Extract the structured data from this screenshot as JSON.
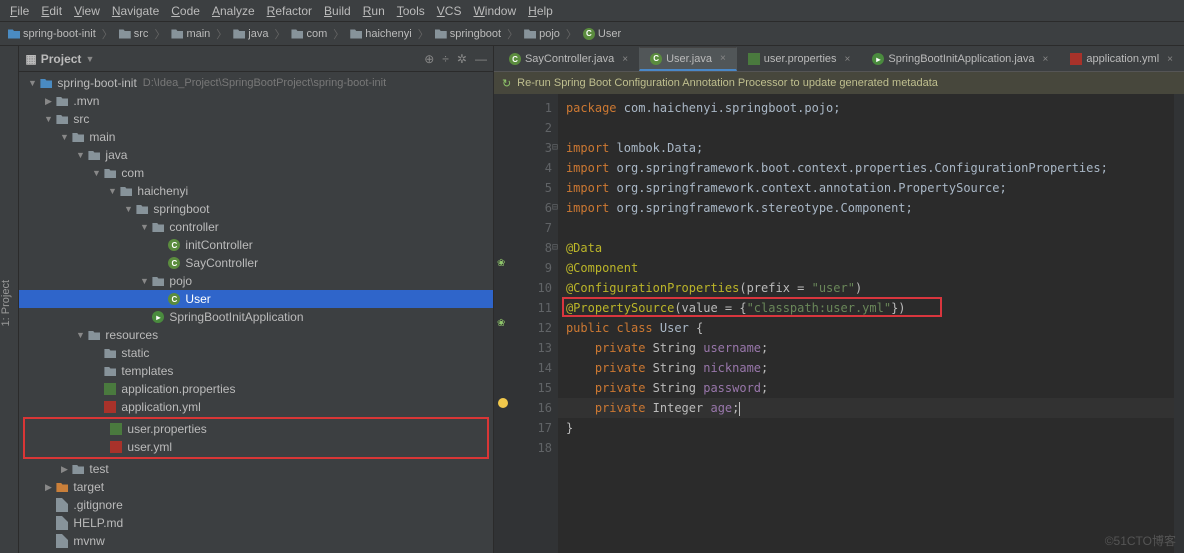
{
  "menu": [
    "File",
    "Edit",
    "View",
    "Navigate",
    "Code",
    "Analyze",
    "Refactor",
    "Build",
    "Run",
    "Tools",
    "VCS",
    "Window",
    "Help"
  ],
  "breadcrumbs": [
    {
      "icon": "folder-blue",
      "label": "spring-boot-init"
    },
    {
      "icon": "folder",
      "label": "src"
    },
    {
      "icon": "folder",
      "label": "main"
    },
    {
      "icon": "folder",
      "label": "java"
    },
    {
      "icon": "folder",
      "label": "com"
    },
    {
      "icon": "folder",
      "label": "haichenyi"
    },
    {
      "icon": "folder",
      "label": "springboot"
    },
    {
      "icon": "folder",
      "label": "pojo"
    },
    {
      "icon": "class",
      "label": "User"
    }
  ],
  "sidebar": {
    "title": "Project",
    "vertical_tab": "1: Project",
    "tree": [
      {
        "d": 0,
        "c": "▼",
        "i": "folder-blue",
        "l": "spring-boot-init",
        "h": "D:\\Idea_Project\\SpringBootProject\\spring-boot-init"
      },
      {
        "d": 1,
        "c": "▶",
        "i": "folder",
        "l": ".mvn"
      },
      {
        "d": 1,
        "c": "▼",
        "i": "folder",
        "l": "src"
      },
      {
        "d": 2,
        "c": "▼",
        "i": "folder",
        "l": "main"
      },
      {
        "d": 3,
        "c": "▼",
        "i": "folder",
        "l": "java"
      },
      {
        "d": 4,
        "c": "▼",
        "i": "folder",
        "l": "com"
      },
      {
        "d": 5,
        "c": "▼",
        "i": "folder",
        "l": "haichenyi"
      },
      {
        "d": 6,
        "c": "▼",
        "i": "folder",
        "l": "springboot"
      },
      {
        "d": 7,
        "c": "▼",
        "i": "folder",
        "l": "controller"
      },
      {
        "d": 8,
        "c": "",
        "i": "class",
        "l": "initController"
      },
      {
        "d": 8,
        "c": "",
        "i": "class",
        "l": "SayController"
      },
      {
        "d": 7,
        "c": "▼",
        "i": "folder",
        "l": "pojo"
      },
      {
        "d": 8,
        "c": "",
        "i": "class",
        "l": "User",
        "sel": true
      },
      {
        "d": 7,
        "c": "",
        "i": "class-run",
        "l": "SpringBootInitApplication"
      },
      {
        "d": 3,
        "c": "▼",
        "i": "folder",
        "l": "resources"
      },
      {
        "d": 4,
        "c": "",
        "i": "folder",
        "l": "static"
      },
      {
        "d": 4,
        "c": "",
        "i": "folder",
        "l": "templates"
      },
      {
        "d": 4,
        "c": "",
        "i": "prop",
        "l": "application.properties"
      },
      {
        "d": 4,
        "c": "",
        "i": "yml",
        "l": "application.yml"
      }
    ],
    "tree_boxed": [
      {
        "d": 4,
        "c": "",
        "i": "prop",
        "l": "user.properties"
      },
      {
        "d": 4,
        "c": "",
        "i": "yml",
        "l": "user.yml"
      }
    ],
    "tree_after": [
      {
        "d": 2,
        "c": "▶",
        "i": "folder",
        "l": "test"
      },
      {
        "d": 1,
        "c": "▶",
        "i": "folder-orange",
        "l": "target"
      },
      {
        "d": 1,
        "c": "",
        "i": "file",
        "l": ".gitignore"
      },
      {
        "d": 1,
        "c": "",
        "i": "file",
        "l": "HELP.md"
      },
      {
        "d": 1,
        "c": "",
        "i": "file",
        "l": "mvnw"
      }
    ]
  },
  "editor": {
    "tabs": [
      {
        "label": "SayController.java",
        "icon": "class"
      },
      {
        "label": "User.java",
        "icon": "class",
        "active": true
      },
      {
        "label": "user.properties",
        "icon": "prop"
      },
      {
        "label": "SpringBootInitApplication.java",
        "icon": "class-run"
      },
      {
        "label": "application.yml",
        "icon": "yml"
      }
    ],
    "banner": "Re-run Spring Boot Configuration Annotation Processor to update generated metadata",
    "lines": [
      {
        "n": 1,
        "html": "<span class='kw'>package</span> <span class='pkg'>com.haichenyi.springboot.pojo;</span>"
      },
      {
        "n": 2,
        "html": ""
      },
      {
        "n": 3,
        "html": "<span class='kw'>import</span> <span class='pkg'>lombok.Data;</span>",
        "fold": "⊟"
      },
      {
        "n": 4,
        "html": "<span class='kw'>import</span> <span class='pkg'>org.springframework.boot.context.properties.ConfigurationProperties;</span>"
      },
      {
        "n": 5,
        "html": "<span class='kw'>import</span> <span class='pkg'>org.springframework.context.annotation.PropertySource;</span>"
      },
      {
        "n": 6,
        "html": "<span class='kw'>import</span> <span class='pkg'>org.springframework.stereotype.Component;</span>",
        "fold": "⊟"
      },
      {
        "n": 7,
        "html": ""
      },
      {
        "n": 8,
        "html": "<span class='ann'>@Data</span>",
        "fold": "⊟"
      },
      {
        "n": 9,
        "html": "<span class='ann'>@Component</span>",
        "g": "leaf"
      },
      {
        "n": 10,
        "html": "<span class='ann'>@ConfigurationProperties</span>(prefix = <span class='str'>\"user\"</span>)"
      },
      {
        "n": 11,
        "html": "<span class='ann'>@PropertySource</span>(value = {<span class='str'>\"classpath:user.yml\"</span>})",
        "boxed": true
      },
      {
        "n": 12,
        "html": "<span class='kw'>public class</span> <span class='type'>User</span> {",
        "g": "leaf"
      },
      {
        "n": 13,
        "html": "    <span class='kw'>private</span> String <span class='field'>username</span>;"
      },
      {
        "n": 14,
        "html": "    <span class='kw'>private</span> String <span class='field'>nickname</span>;"
      },
      {
        "n": 15,
        "html": "    <span class='kw'>private</span> String <span class='field'>password</span>;"
      },
      {
        "n": 16,
        "html": "    <span class='kw'>private</span> Integer <span class='field'>age</span>;<span class='caret-line'></span>",
        "current": true,
        "bulb": true
      },
      {
        "n": 17,
        "html": "}"
      },
      {
        "n": 18,
        "html": ""
      }
    ]
  },
  "watermark": "©51CTO博客"
}
